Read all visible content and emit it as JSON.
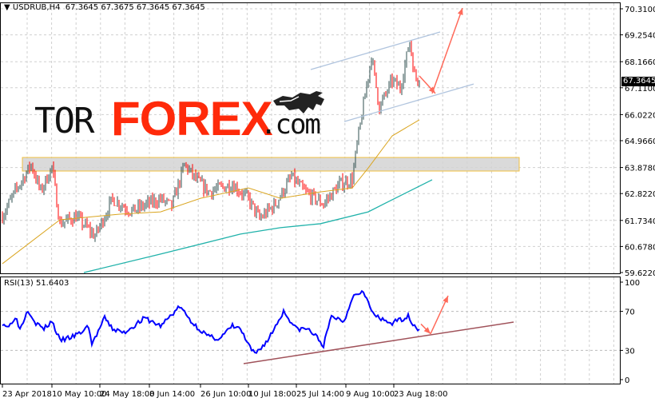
{
  "header": {
    "title": "USDRUB,H4  67.3645 67.3675 67.3645 67.3645",
    "menu_icon": "triangle-down-icon"
  },
  "logo": {
    "tor": "TOR",
    "forex": "FOREX",
    "com": ".com",
    "icon": "bull-icon"
  },
  "current_price": "67.3645",
  "rsi_title": "RSI(13) 51.6403",
  "colors": {
    "up": "#2f4f4f",
    "down": "#ff0000",
    "ma_fast": "#daa520",
    "ma_slow": "#20b2aa",
    "rsi": "#0000ff",
    "arrow": "#ff6a5a",
    "channel": "#b0c4de",
    "rsi_trend": "#a0525a",
    "zone": "#d3d3d3",
    "zone_border": "#f0c040"
  },
  "chart_data": [
    {
      "type": "candlestick",
      "symbol": "USDRUB",
      "timeframe": "H4",
      "last": {
        "open": 67.3645,
        "high": 67.3675,
        "low": 67.3645,
        "close": 67.3645
      },
      "ylim": [
        59.622,
        70.31
      ],
      "y_ticks": [
        "70.3100",
        "69.2540",
        "68.1660",
        "67.1100",
        "66.0220",
        "64.9660",
        "63.8780",
        "62.8220",
        "61.7340",
        "60.6780",
        "59.6220"
      ],
      "x_ticks": [
        {
          "bar": 0,
          "label": "23 Apr 2018"
        },
        {
          "bar": 31,
          "label": "10 May 10:00"
        },
        {
          "bar": 61,
          "label": "24 May 18:00"
        },
        {
          "bar": 92,
          "label": "8 Jun 14:00"
        },
        {
          "bar": 124,
          "label": "26 Jun 10:00"
        },
        {
          "bar": 154,
          "label": "10 Jul 18:00"
        },
        {
          "bar": 184,
          "label": "25 Jul 14:00"
        },
        {
          "bar": 215,
          "label": "9 Aug 10:00"
        },
        {
          "bar": 245,
          "label": "23 Aug 18:00"
        }
      ],
      "close_path": [
        [
          0,
          61.92
        ],
        [
          8,
          62.9
        ],
        [
          18,
          64.0
        ],
        [
          24,
          62.9
        ],
        [
          31,
          63.9
        ],
        [
          36,
          61.6
        ],
        [
          46,
          61.9
        ],
        [
          58,
          61.1
        ],
        [
          69,
          62.6
        ],
        [
          81,
          62.1
        ],
        [
          91,
          62.4
        ],
        [
          99,
          62.6
        ],
        [
          106,
          62.3
        ],
        [
          114,
          64.0
        ],
        [
          121,
          63.4
        ],
        [
          129,
          62.9
        ],
        [
          144,
          63.2
        ],
        [
          154,
          62.6
        ],
        [
          161,
          61.8
        ],
        [
          171,
          62.4
        ],
        [
          181,
          63.5
        ],
        [
          189,
          62.9
        ],
        [
          201,
          62.4
        ],
        [
          211,
          63.2
        ],
        [
          219,
          63.4
        ],
        [
          222,
          64.8
        ],
        [
          225,
          66.0
        ],
        [
          231,
          68.4
        ],
        [
          236,
          66.3
        ],
        [
          244,
          67.4
        ],
        [
          249,
          67.1
        ],
        [
          255,
          69.0
        ],
        [
          258,
          67.6
        ],
        [
          261,
          67.3645
        ]
      ],
      "ma_fast": [
        [
          0,
          59.98
        ],
        [
          36,
          61.76
        ],
        [
          74,
          61.99
        ],
        [
          99,
          62.08
        ],
        [
          124,
          62.63
        ],
        [
          154,
          63.05
        ],
        [
          174,
          62.63
        ],
        [
          199,
          62.89
        ],
        [
          219,
          63.05
        ],
        [
          229,
          63.86
        ],
        [
          244,
          65.16
        ],
        [
          261,
          65.81
        ]
      ],
      "ma_slow": [
        [
          51,
          59.62
        ],
        [
          99,
          60.37
        ],
        [
          149,
          61.18
        ],
        [
          174,
          61.44
        ],
        [
          199,
          61.6
        ],
        [
          229,
          62.08
        ],
        [
          239,
          62.41
        ],
        [
          269,
          63.38
        ]
      ],
      "support_zone": {
        "from_bar": 11,
        "to_bar": 322,
        "low": 63.735,
        "high": 64.285
      },
      "channel": [
        {
          "from": [
            193,
            67.85
          ],
          "to": [
            274,
            69.37
          ]
        },
        {
          "from": [
            214,
            65.74
          ],
          "to": [
            295,
            67.26
          ]
        }
      ],
      "arrows": [
        {
          "from": [
            261,
            67.59
          ],
          "to": [
            271,
            66.88
          ]
        },
        {
          "from": [
            269,
            66.88
          ],
          "to": [
            288,
            70.34
          ]
        }
      ]
    },
    {
      "type": "line",
      "title": "RSI(13) 51.6403",
      "ylim": [
        0,
        100
      ],
      "y_ticks": [
        "100",
        "70",
        "30",
        "0"
      ],
      "levels": [
        70,
        30
      ],
      "rsi": [
        [
          0,
          58
        ],
        [
          4,
          54
        ],
        [
          8,
          65
        ],
        [
          11,
          52
        ],
        [
          16,
          72
        ],
        [
          21,
          58
        ],
        [
          26,
          52
        ],
        [
          31,
          60
        ],
        [
          36,
          40
        ],
        [
          44,
          44
        ],
        [
          49,
          48
        ],
        [
          54,
          55
        ],
        [
          56,
          36
        ],
        [
          64,
          63
        ],
        [
          69,
          52
        ],
        [
          76,
          48
        ],
        [
          89,
          63
        ],
        [
          99,
          55
        ],
        [
          111,
          75
        ],
        [
          119,
          58
        ],
        [
          129,
          44
        ],
        [
          136,
          42
        ],
        [
          144,
          55
        ],
        [
          149,
          52
        ],
        [
          154,
          35
        ],
        [
          158,
          26
        ],
        [
          166,
          40
        ],
        [
          176,
          70
        ],
        [
          184,
          52
        ],
        [
          191,
          52
        ],
        [
          196,
          45
        ],
        [
          201,
          35
        ],
        [
          206,
          65
        ],
        [
          214,
          60
        ],
        [
          219,
          85
        ],
        [
          226,
          92
        ],
        [
          231,
          70
        ],
        [
          236,
          62
        ],
        [
          244,
          58
        ],
        [
          254,
          65
        ],
        [
          259,
          53
        ],
        [
          261,
          51.64
        ]
      ],
      "trendline": {
        "from": [
          151,
          16.4
        ],
        "to": [
          320,
          59
        ]
      },
      "arrows": [
        {
          "from": [
            262,
            57
          ],
          "to": [
            268,
            47
          ]
        },
        {
          "from": [
            268,
            47
          ],
          "to": [
            279,
            86
          ]
        }
      ]
    }
  ]
}
